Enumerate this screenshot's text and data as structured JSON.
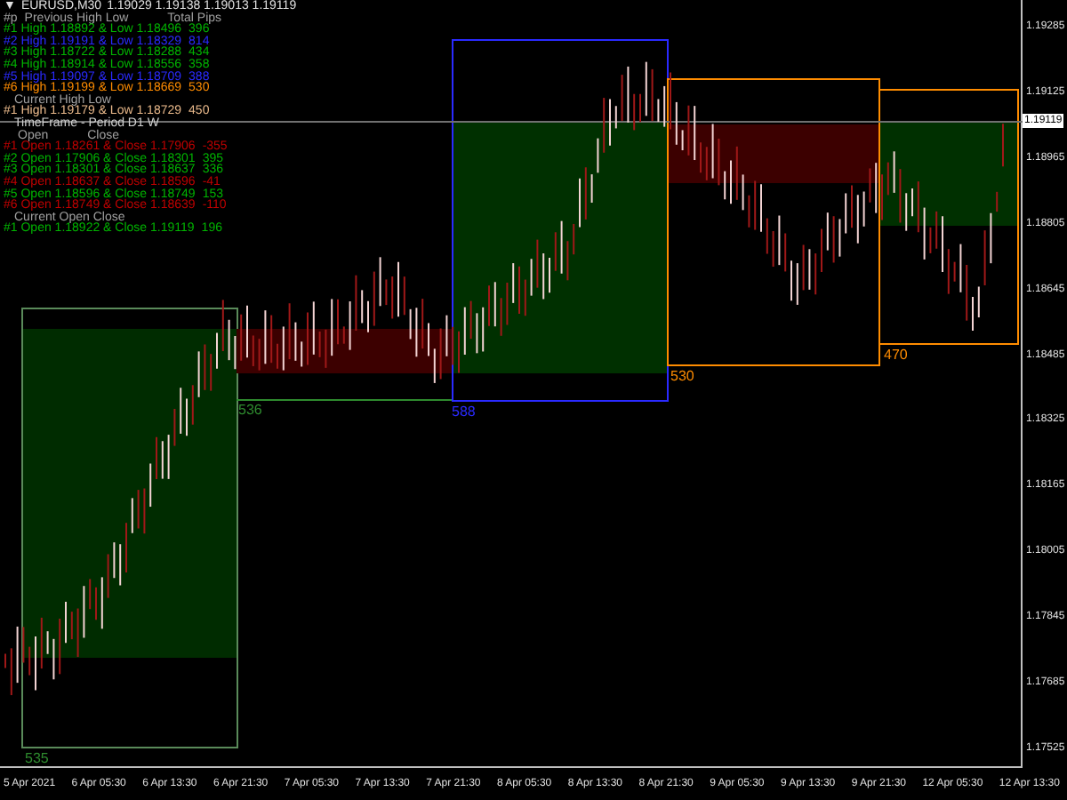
{
  "header": {
    "toggle": "▼",
    "symbol": "EURUSD,M30",
    "quotes": "1.19029 1.19138 1.19013 1.19119"
  },
  "previous_heading": {
    "number": "#p",
    "title": "Previous High Low",
    "pips": "Total Pips"
  },
  "previous_rows": [
    {
      "label": "#1 High 1.18892 & Low 1.18496",
      "pips": "396",
      "color": "#00b400"
    },
    {
      "label": "#2 High 1.19191 & Low 1.18329",
      "pips": "814",
      "color": "#2a2aff"
    },
    {
      "label": "#3 High 1.18722 & Low 1.18288",
      "pips": "434",
      "color": "#00b400"
    },
    {
      "label": "#4 High 1.18914 & Low 1.18556",
      "pips": "358",
      "color": "#00b400"
    },
    {
      "label": "#5 High 1.19097 & Low 1.18709",
      "pips": "388",
      "color": "#2a2aff"
    },
    {
      "label": "#6 High 1.19199 & Low 1.18669",
      "pips": "530",
      "color": "#ff8c00"
    }
  ],
  "current_high_low": {
    "title": "Current High Low",
    "row": {
      "label": "#1 High 1.19179 & Low 1.18729",
      "pips": "450",
      "color": "#e8b88a"
    }
  },
  "timeframe": "TimeFrame - Period D1 W",
  "open_close_heading": {
    "open": "Open",
    "close": "Close"
  },
  "open_close_rows": [
    {
      "label": "#1 Open 1.18261 & Close 1.17906",
      "pips": "-355",
      "color": "#c00000"
    },
    {
      "label": "#2 Open 1.17906 & Close 1.18301",
      "pips": "395",
      "color": "#00b400"
    },
    {
      "label": "#3 Open 1.18301 & Close 1.18637",
      "pips": "336",
      "color": "#00b400"
    },
    {
      "label": "#4 Open 1.18637 & Close 1.18596",
      "pips": "-41",
      "color": "#c00000"
    },
    {
      "label": "#5 Open 1.18596 & Close 1.18749",
      "pips": "153",
      "color": "#00b400"
    },
    {
      "label": "#6 Open 1.18749 & Close 1.18639",
      "pips": "-110",
      "color": "#c00000"
    }
  ],
  "current_open_close": {
    "title": "Current Open Close",
    "row": {
      "label": "#1 Open 1.18922 & Close 1.19119",
      "pips": "196",
      "color": "#00b400"
    }
  },
  "boxes": [
    {
      "label": "535",
      "color": "#2e8b2e"
    },
    {
      "label": "536",
      "color": "#2e8b2e"
    },
    {
      "label": "588",
      "color": "#2a2aff"
    },
    {
      "label": "530",
      "color": "#ff8c00"
    },
    {
      "label": "470",
      "color": "#ff8c00"
    }
  ],
  "price_axis": [
    "1.19285",
    "1.19125",
    "1.18965",
    "1.18805",
    "1.18645",
    "1.18485",
    "1.18325",
    "1.18165",
    "1.18005",
    "1.17845",
    "1.17685",
    "1.17525"
  ],
  "current_price": "1.19119",
  "time_axis": [
    "5 Apr 2021",
    "6 Apr 05:30",
    "6 Apr 13:30",
    "6 Apr 21:30",
    "7 Apr 05:30",
    "7 Apr 13:30",
    "7 Apr 21:30",
    "8 Apr 05:30",
    "8 Apr 13:30",
    "8 Apr 21:30",
    "9 Apr 05:30",
    "9 Apr 13:30",
    "9 Apr 21:30",
    "12 Apr 05:30",
    "12 Apr 13:30"
  ]
}
